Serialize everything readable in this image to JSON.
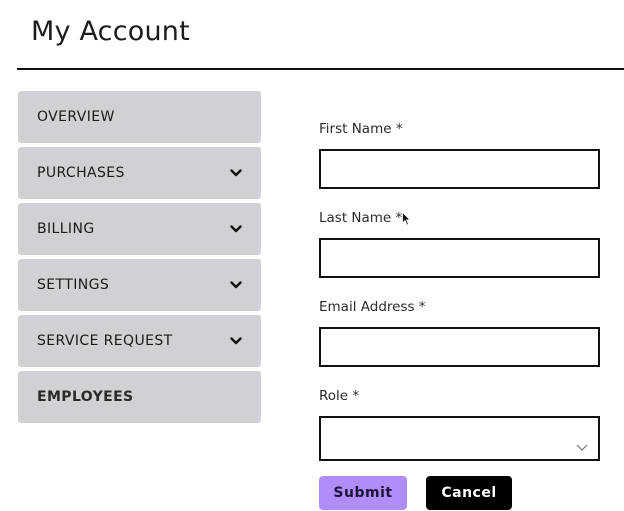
{
  "page": {
    "title": "My Account"
  },
  "sidebar": {
    "items": [
      {
        "label": "OVERVIEW",
        "expandable": false,
        "icon": "none"
      },
      {
        "label": "PURCHASES",
        "expandable": true,
        "icon": "chevron-down-icon"
      },
      {
        "label": "BILLING",
        "expandable": true,
        "icon": "chevron-down-icon"
      },
      {
        "label": "SETTINGS",
        "expandable": true,
        "icon": "chevron-down-icon"
      },
      {
        "label": "SERVICE REQUEST",
        "expandable": true,
        "icon": "chevron-down-icon"
      },
      {
        "label": "EMPLOYEES",
        "expandable": false,
        "active": true,
        "icon": "none"
      }
    ]
  },
  "form": {
    "first_name": {
      "label": "First Name *",
      "value": "",
      "placeholder": ""
    },
    "last_name": {
      "label": "Last Name *",
      "value": "",
      "placeholder": ""
    },
    "email": {
      "label": "Email Address *",
      "value": "",
      "placeholder": ""
    },
    "role": {
      "label": "Role *",
      "selected": ""
    },
    "submit_label": "Submit",
    "cancel_label": "Cancel"
  },
  "colors": {
    "submit_bg": "#b18cfb",
    "cancel_bg": "#000000",
    "sidebar_item_bg": "#cfd1d5"
  }
}
